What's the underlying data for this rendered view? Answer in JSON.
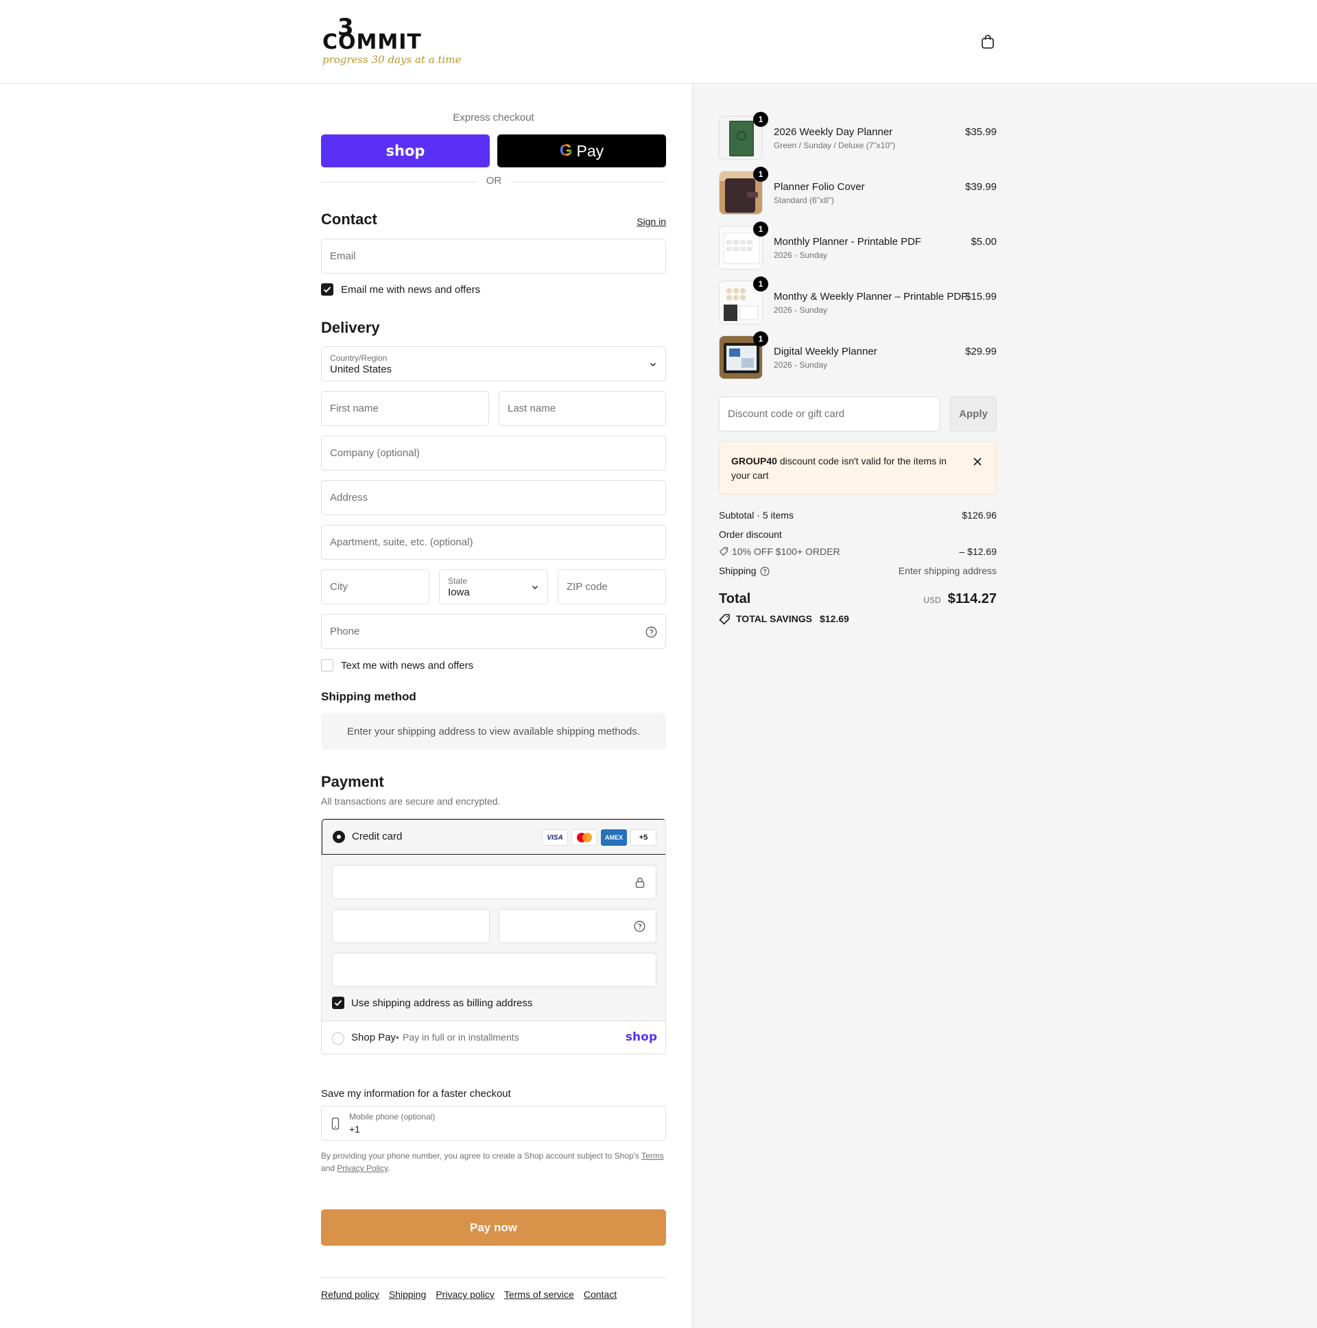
{
  "header": {
    "logo": {
      "numeral": "3",
      "word": "COMMIT",
      "tagline": "progress 30 days at a time"
    }
  },
  "express": {
    "label": "Express checkout",
    "shop_label": "shop",
    "gpay_g": "G",
    "gpay_label": "Pay",
    "or_label": "OR"
  },
  "contact": {
    "title": "Contact",
    "sign_in": "Sign in",
    "email_placeholder": "Email",
    "news_label": "Email me with news and offers"
  },
  "delivery": {
    "title": "Delivery",
    "country_label": "Country/Region",
    "country_value": "United States",
    "first_name": "First name",
    "last_name": "Last name",
    "company": "Company (optional)",
    "address": "Address",
    "apartment": "Apartment, suite, etc. (optional)",
    "city": "City",
    "state_label": "State",
    "state_value": "Iowa",
    "zip": "ZIP code",
    "phone": "Phone",
    "text_label": "Text me with news and offers"
  },
  "shipping_method": {
    "title": "Shipping method",
    "message": "Enter your shipping address to view available shipping methods."
  },
  "payment": {
    "title": "Payment",
    "subtitle": "All transactions are secure and encrypted.",
    "credit_card_label": "Credit card",
    "cards": [
      "VISA",
      "MC",
      "AMEX"
    ],
    "more_cards": "+5",
    "billing_label": "Use shipping address as billing address",
    "shop_pay_label": "Shop Pay",
    "shop_pay_sep": "•",
    "shop_pay_desc": "Pay in full or in installments",
    "shop_pay_logo": "shop"
  },
  "save_info": {
    "title": "Save my information for a faster checkout",
    "mobile_label": "Mobile phone (optional)",
    "mobile_value": "+1",
    "legal_prefix": "By providing your phone number, you agree to create a Shop account subject to Shop's",
    "legal_terms": "Terms",
    "legal_and": "and",
    "legal_privacy": "Privacy Policy",
    "legal_end": "."
  },
  "pay_now": "Pay now",
  "footer": {
    "links": [
      "Refund policy",
      "Shipping",
      "Privacy policy",
      "Terms of service",
      "Contact"
    ]
  },
  "order": {
    "items": [
      {
        "name": "2026 Weekly Day Planner",
        "variant": "Green / Sunday / Deluxe (7\"x10\")",
        "price": "$35.99",
        "qty": "1"
      },
      {
        "name": "Planner Folio Cover",
        "variant": "Standard (6\"x8\")",
        "price": "$39.99",
        "qty": "1"
      },
      {
        "name": "Monthly Planner - Printable PDF",
        "variant": "2026 - Sunday",
        "price": "$5.00",
        "qty": "1"
      },
      {
        "name": "Monthy & Weekly Planner – Printable PDF",
        "variant": "2026 - Sunday",
        "price": "$15.99",
        "qty": "1"
      },
      {
        "name": "Digital Weekly Planner",
        "variant": "2026 - Sunday",
        "price": "$29.99",
        "qty": "1"
      }
    ],
    "discount_placeholder": "Discount code or gift card",
    "apply": "Apply",
    "error_code": "GROUP40",
    "error_msg": "discount code isn't valid for the items in your cart",
    "subtotal_label": "Subtotal · 5 items",
    "subtotal_value": "$126.96",
    "order_discount_label": "Order discount",
    "discount_name": "10% OFF $100+ ORDER",
    "discount_value": "– $12.69",
    "shipping_label": "Shipping",
    "shipping_value": "Enter shipping address",
    "total_label": "Total",
    "currency": "USD",
    "total_value": "$114.27",
    "savings_label": "TOTAL SAVINGS",
    "savings_value": "$12.69"
  },
  "colors": {
    "shop_purple": "#5a31f4",
    "pay_now": "#d9924a",
    "error_bg": "#fff4e8"
  }
}
